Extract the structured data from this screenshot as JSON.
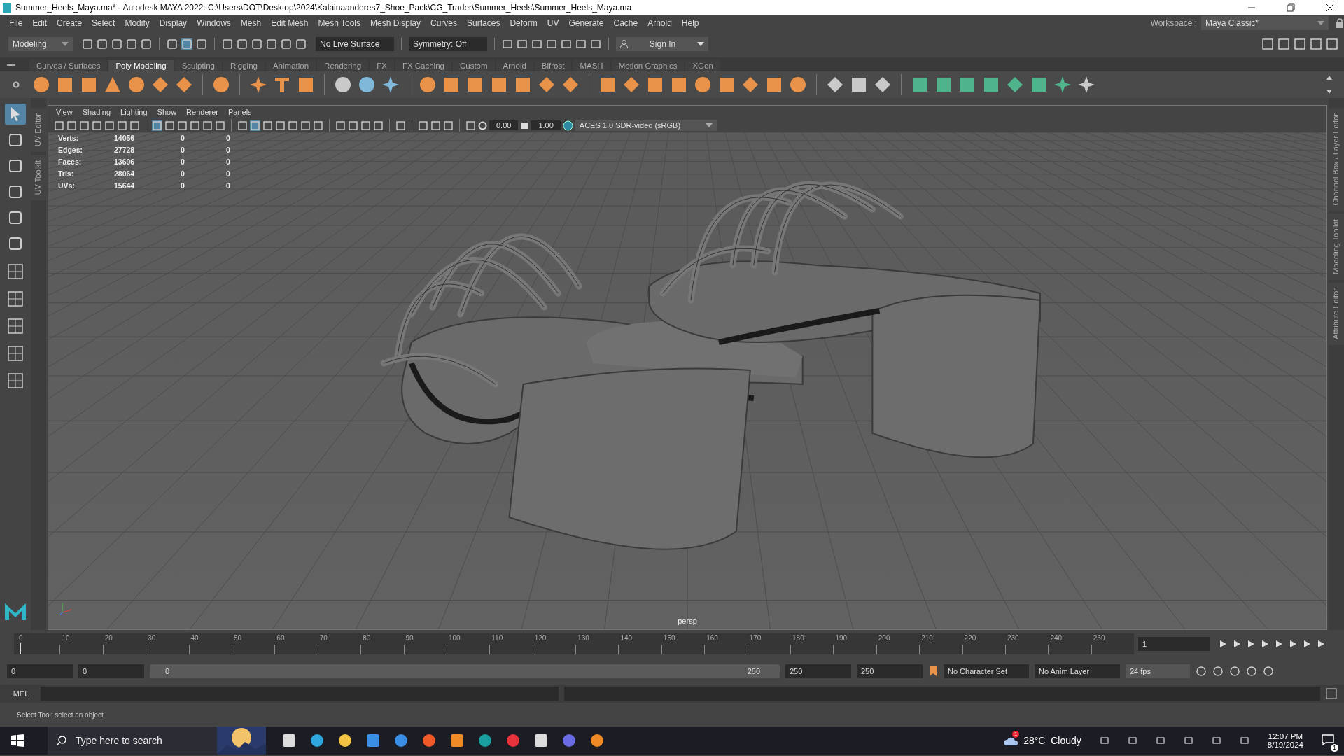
{
  "window": {
    "title": "Summer_Heels_Maya.ma* - Autodesk MAYA 2022: C:\\Users\\DOT\\Desktop\\2024\\Kalainaanderes7_Shoe_Pack\\CG_Trader\\Summer_Heels\\Summer_Heels_Maya.ma"
  },
  "menu_bar": [
    "File",
    "Edit",
    "Create",
    "Select",
    "Modify",
    "Display",
    "Windows",
    "Mesh",
    "Edit Mesh",
    "Mesh Tools",
    "Mesh Display",
    "Curves",
    "Surfaces",
    "Deform",
    "UV",
    "Generate",
    "Cache",
    "Arnold",
    "Help"
  ],
  "status_line": {
    "mode": "Modeling",
    "live_surface": "No Live Surface",
    "symmetry": "Symmetry: Off",
    "sign_in": "Sign In",
    "workspace_label": "Workspace :",
    "workspace": "Maya Classic*"
  },
  "shelf_tabs": [
    {
      "label": "Curves / Surfaces",
      "selected": false
    },
    {
      "label": "Poly Modeling",
      "selected": true
    },
    {
      "label": "Sculpting",
      "selected": false
    },
    {
      "label": "Rigging",
      "selected": false
    },
    {
      "label": "Animation",
      "selected": false
    },
    {
      "label": "Rendering",
      "selected": false
    },
    {
      "label": "FX",
      "selected": false
    },
    {
      "label": "FX Caching",
      "selected": false
    },
    {
      "label": "Custom",
      "selected": false
    },
    {
      "label": "Arnold",
      "selected": false
    },
    {
      "label": "Bifrost",
      "selected": false
    },
    {
      "label": "MASH",
      "selected": false
    },
    {
      "label": "Motion Graphics",
      "selected": false
    },
    {
      "label": "XGen",
      "selected": false
    }
  ],
  "tools": [
    {
      "selected": true
    },
    {
      "selected": false
    },
    {
      "selected": false
    },
    {
      "selected": false
    },
    {
      "selected": false
    },
    {
      "selected": false
    }
  ],
  "side_tabs_left": [
    "UV Editor",
    "UV Toolkit"
  ],
  "side_tabs_right": [
    "Channel Box / Layer Editor",
    "Modeling Toolkit",
    "Attribute Editor"
  ],
  "viewport": {
    "menu": [
      "View",
      "Shading",
      "Lighting",
      "Show",
      "Renderer",
      "Panels"
    ],
    "exposure": "0.00",
    "gamma": "1.00",
    "color_space": "ACES 1.0 SDR-video (sRGB)",
    "hud": [
      {
        "label": "Verts:",
        "values": [
          "14056",
          "0",
          "0"
        ]
      },
      {
        "label": "Edges:",
        "values": [
          "27728",
          "0",
          "0"
        ]
      },
      {
        "label": "Faces:",
        "values": [
          "13696",
          "0",
          "0"
        ]
      },
      {
        "label": "Tris:",
        "values": [
          "28064",
          "0",
          "0"
        ]
      },
      {
        "label": "UVs:",
        "values": [
          "15644",
          "0",
          "0"
        ]
      }
    ],
    "camera": "persp"
  },
  "timeline": {
    "ticks": [
      "0",
      "10",
      "20",
      "30",
      "40",
      "50",
      "60",
      "70",
      "80",
      "90",
      "100",
      "110",
      "120",
      "130",
      "140",
      "150",
      "160",
      "170",
      "180",
      "190",
      "200",
      "210",
      "220",
      "230",
      "240",
      "250"
    ],
    "current_frame": "1",
    "level": 0.004
  },
  "range": {
    "start": "0",
    "playback_start": "0",
    "slider_start": "0",
    "slider_end": "250",
    "level": 1,
    "playback_end": "250",
    "end": "250",
    "character_set": "No Character Set",
    "anim_layer": "No Anim Layer",
    "fps": "24 fps"
  },
  "command_line": {
    "label": "MEL"
  },
  "help_line": "Select Tool: select an object",
  "taskbar": {
    "search_placeholder": "Type here to search",
    "weather_badge": "1",
    "weather": "28°C  Cloudy",
    "time": "12:07 PM",
    "date": "8/19/2024",
    "notification_count": "1"
  }
}
